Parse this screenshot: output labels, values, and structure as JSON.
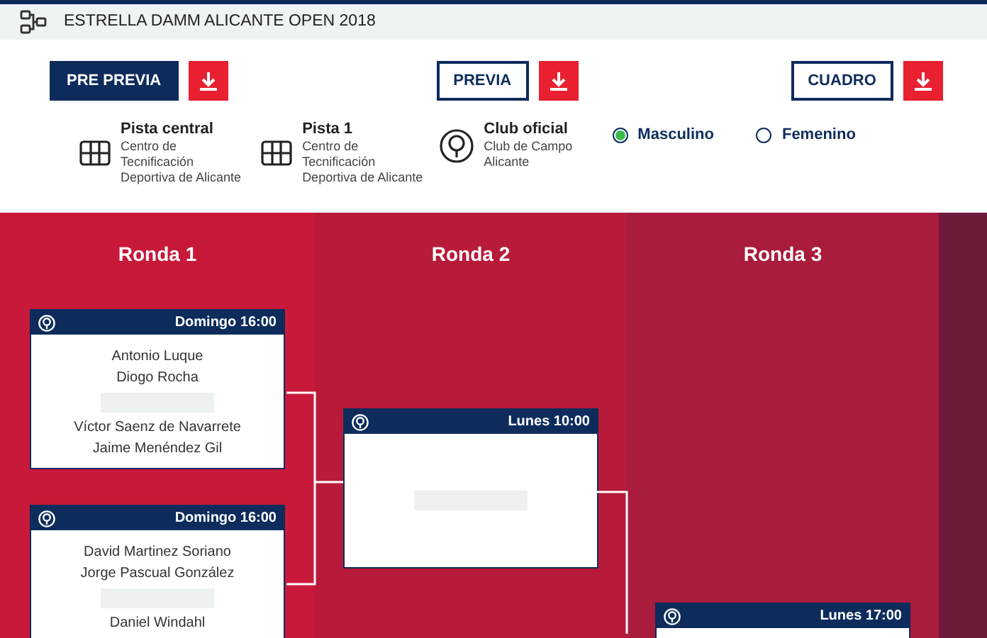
{
  "header": {
    "title": "ESTRELLA DAMM ALICANTE OPEN 2018"
  },
  "downloads": [
    {
      "label": "PRE PREVIA",
      "selected": true
    },
    {
      "label": "PREVIA",
      "selected": false
    },
    {
      "label": "CUADRO",
      "selected": false
    }
  ],
  "venues": [
    {
      "kind": "court",
      "name": "Pista central",
      "lines": [
        "Centro de",
        "Tecnificación",
        "Deportiva de Alicante"
      ]
    },
    {
      "kind": "court",
      "name": "Pista 1",
      "lines": [
        "Centro de",
        "Tecnificación",
        "Deportiva de Alicante"
      ]
    },
    {
      "kind": "club",
      "name": "Club oficial",
      "lines": [
        "Club de Campo",
        "Alicante"
      ]
    }
  ],
  "gender": [
    {
      "label": "Masculino",
      "selected": true
    },
    {
      "label": "Femenino",
      "selected": false
    }
  ],
  "rounds": [
    {
      "title": "Ronda 1",
      "matches": [
        {
          "time": "Domingo 16:00",
          "teams": [
            [
              "Antonio Luque",
              "Diogo Rocha"
            ],
            [
              "Víctor Saenz de Navarrete",
              "Jaime Menéndez Gil"
            ]
          ]
        },
        {
          "time": "Domingo 16:00",
          "teams": [
            [
              "David Martinez Soriano",
              "Jorge Pascual González"
            ],
            [
              "Daniel Windahl"
            ]
          ]
        }
      ]
    },
    {
      "title": "Ronda 2",
      "matches": [
        {
          "time": "Lunes 10:00",
          "score_pending": true
        }
      ]
    },
    {
      "title": "Ronda 3",
      "matches": [
        {
          "time": "Lunes 17:00"
        }
      ]
    }
  ]
}
